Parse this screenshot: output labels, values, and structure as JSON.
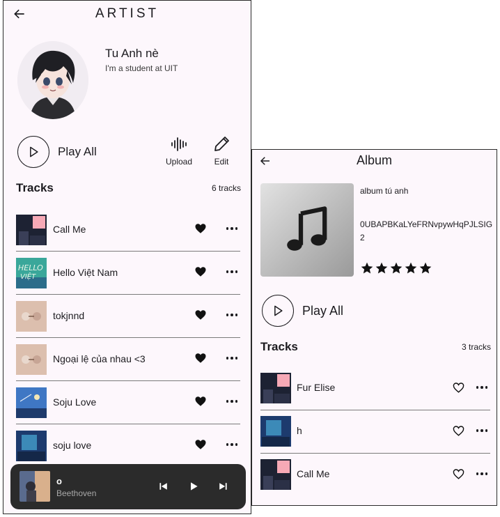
{
  "artist_screen": {
    "title": "ARTIST",
    "profile": {
      "name": "Tu Anh nè",
      "bio": "I'm a student at UIT"
    },
    "play_all_label": "Play All",
    "actions": [
      {
        "label": "Upload",
        "icon": "waveform-icon"
      },
      {
        "label": "Edit",
        "icon": "pencil-icon"
      }
    ],
    "tracks_title": "Tracks",
    "tracks_count": "6 tracks",
    "tracks": [
      {
        "name": "Call Me",
        "liked": true
      },
      {
        "name": "Hello Việt Nam",
        "liked": true
      },
      {
        "name": "tokjnnd",
        "liked": true
      },
      {
        "name": "Ngoại lệ của nhau <3",
        "liked": true
      },
      {
        "name": "Soju Love",
        "liked": true
      },
      {
        "name": "soju love",
        "liked": true
      }
    ],
    "now_playing": {
      "title": "o",
      "artist": "Beethoven"
    }
  },
  "album_screen": {
    "title": "Album",
    "album_name": "album tú anh",
    "album_id": "0UBAPBKaLYeFRNvpywHqPJLSIG2",
    "rating": 5,
    "play_all_label": "Play All",
    "tracks_title": "Tracks",
    "tracks_count": "3 tracks",
    "tracks": [
      {
        "name": "Fur Elise",
        "liked": false
      },
      {
        "name": "h",
        "liked": false
      },
      {
        "name": "Call Me",
        "liked": false
      }
    ]
  },
  "colors": {
    "background": "#fdf7fc",
    "mini_player": "#2b2b2b",
    "text": "#1c1b1f"
  }
}
